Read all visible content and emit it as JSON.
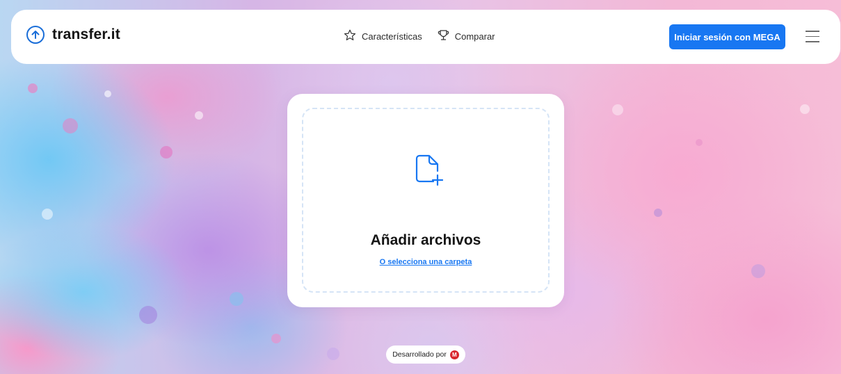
{
  "header": {
    "logo_text": "transfer.it",
    "nav": [
      {
        "label": "Características",
        "icon": "star-icon"
      },
      {
        "label": "Comparar",
        "icon": "trophy-icon"
      }
    ],
    "login_label": "Iniciar sesión con MEGA",
    "menu_icon": "hamburger-menu-icon"
  },
  "upload": {
    "icon": "file-add-icon",
    "title": "Añadir archivos",
    "folder_link": "O selecciona una carpeta"
  },
  "footer": {
    "developed_by": "Desarrollado por",
    "brand_icon": "mega-logo-icon"
  },
  "colors": {
    "accent": "#1877f2",
    "mega_red": "#d9272e"
  }
}
